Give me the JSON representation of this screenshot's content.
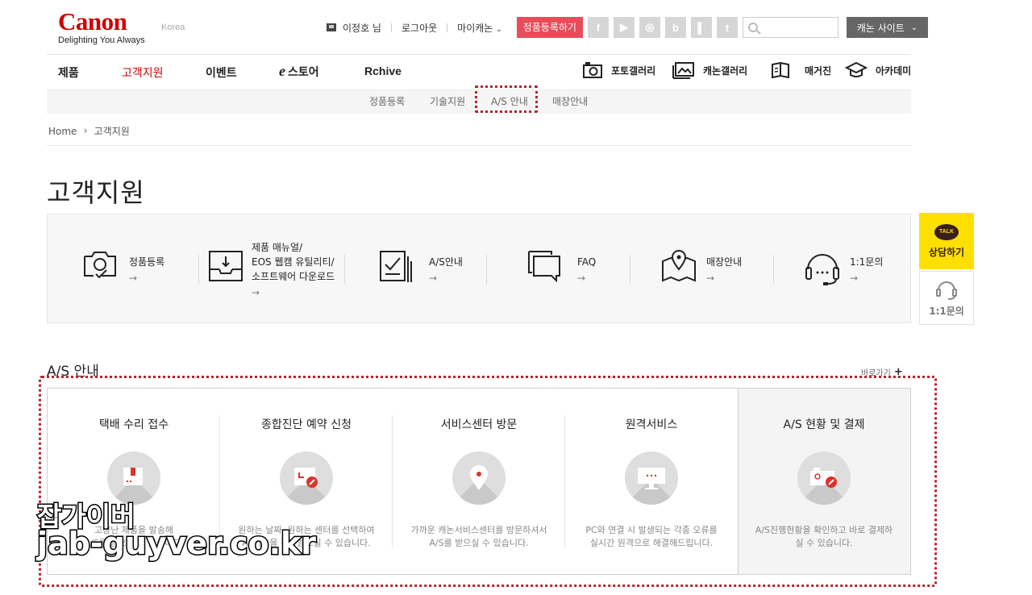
{
  "header": {
    "logo_word": "Canon",
    "logo_tagline": "Delighting You Always",
    "region": "Korea",
    "user_name": "이정호 님",
    "logout": "로그아웃",
    "my_canon": "마이캐논",
    "register_button": "정품등록하기",
    "social": [
      "f",
      "▶",
      "◎",
      "b",
      "▌",
      "t"
    ],
    "search_placeholder": "",
    "site_button": "캐논 사이트"
  },
  "nav": {
    "items": [
      "제품",
      "고객지원",
      "이벤트",
      "스토어",
      "Rchive"
    ],
    "store_prefix": "e",
    "active": "고객지원",
    "right": [
      "포토갤러리",
      "캐논갤러리",
      "매거진",
      "아카데미"
    ]
  },
  "subnav": {
    "items": [
      "정품등록",
      "기술지원",
      "A/S 안내",
      "매장안내"
    ],
    "highlighted": "A/S 안내"
  },
  "breadcrumb": {
    "home": "Home",
    "current": "고객지원"
  },
  "page_title": "고객지원",
  "quick_menu": [
    {
      "label": "정품등록",
      "arrow": "→"
    },
    {
      "label_lines": [
        "제품 매뉴얼/",
        "EOS 웹캠 유틸리티/",
        "소프트웨어 다운로드"
      ],
      "arrow": "→"
    },
    {
      "label": "A/S안내",
      "arrow": "→"
    },
    {
      "label": "FAQ",
      "arrow": "→"
    },
    {
      "label": "매장안내",
      "arrow": "→"
    },
    {
      "label": "1:1문의",
      "arrow": "→"
    }
  ],
  "side": {
    "talk": "TALK",
    "kakao_label": "상담하기",
    "inquiry_label": "1:1문의"
  },
  "as_section": {
    "title": "A/S 안내",
    "shortcut": "바로가기",
    "shortcut_plus": "+",
    "cards": [
      {
        "title": "택배 수리 접수",
        "desc_lines": [
          "고장난 제품을 발송해",
          "A/S를 받으실 수 있습니다."
        ]
      },
      {
        "title": "종합진단 예약 신청",
        "desc_lines": [
          "원하는 날짜, 원하는 센터를 선택하여",
          "AF기능을 진단받으실 수 있습니다."
        ]
      },
      {
        "title": "서비스센터 방문",
        "desc_lines": [
          "가까운 캐논서비스센터를 방문하셔서",
          "A/S를 받으실 수 있습니다."
        ]
      },
      {
        "title": "원격서비스",
        "desc_lines": [
          "PC와 연결 시 발생되는 각종 오류를",
          "실시간 원격으로 해결해드립니다."
        ]
      },
      {
        "title": "A/S 현황 및 결제",
        "desc_lines": [
          "A/S진행현황을 확인하고 바로 결제하",
          "실 수 있습니다."
        ]
      }
    ]
  },
  "watermark": {
    "line1": "잡가이버",
    "line2": "jab-guyver.co.kr"
  },
  "colors": {
    "brand": "#cc0000",
    "register": "#e84b5a",
    "highlight": "#b8232b",
    "kakao": "#fde000"
  }
}
